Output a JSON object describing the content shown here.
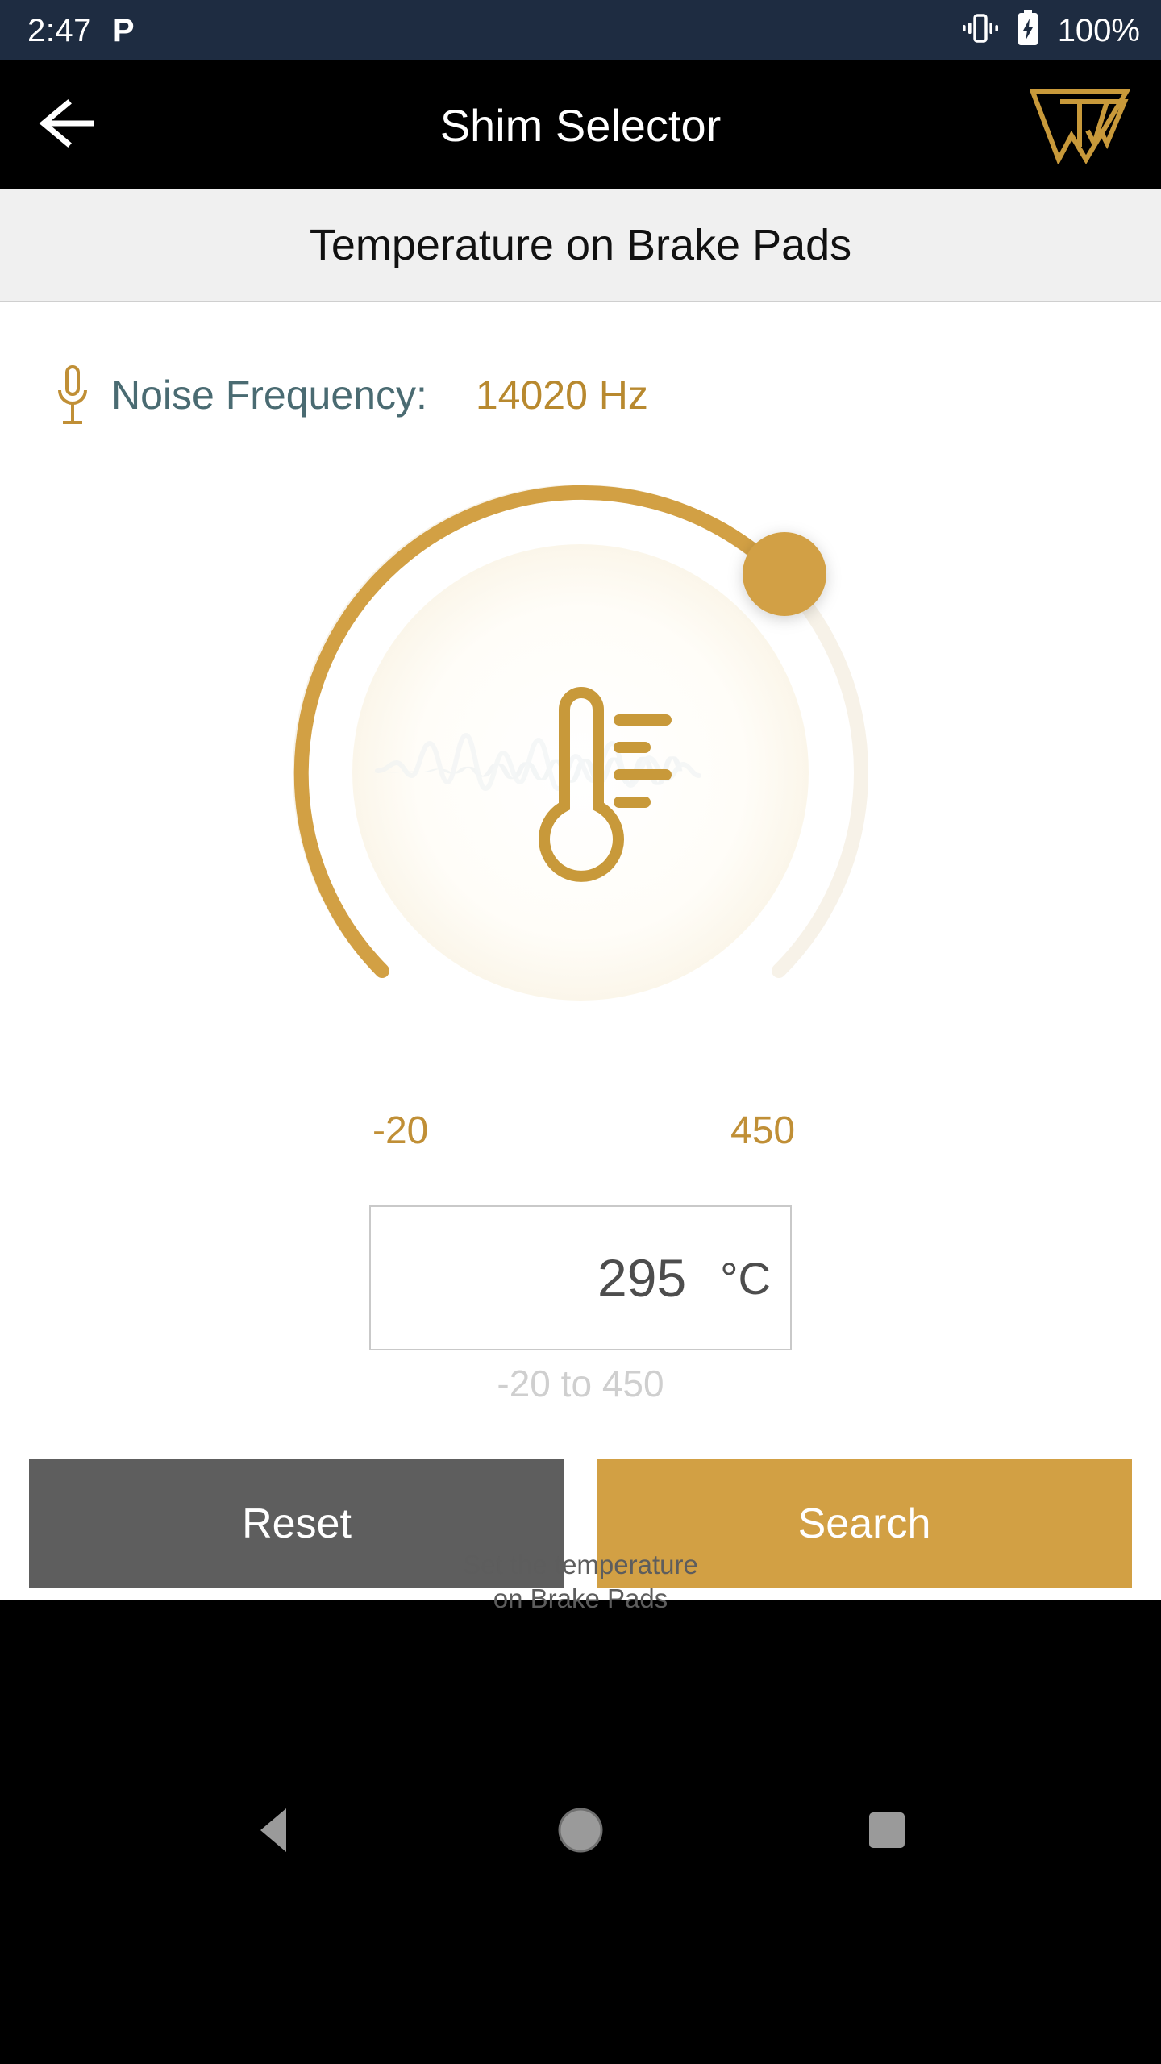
{
  "status_bar": {
    "time": "2:47",
    "app_icon_glyph": "P",
    "icons": [
      "vibrate-icon",
      "battery-charging-icon"
    ],
    "battery_percent": "100%",
    "background_color": "#1e2c41"
  },
  "app_bar": {
    "back_icon": "arrow-left-icon",
    "title": "Shim Selector",
    "logo_name": "tw-brand-logo",
    "background_color": "#000000",
    "logo_color": "#c8993a"
  },
  "subtitle": {
    "text": "Temperature on Brake Pads"
  },
  "noise_frequency": {
    "icon": "microphone-icon",
    "label": "Noise Frequency:",
    "value": "14020 Hz",
    "label_color": "#4a6b72",
    "value_color": "#b8892f"
  },
  "gauge": {
    "icon": "thermometer-icon",
    "caption_line1": "Set the temperature",
    "caption_line2": "on Brake Pads",
    "min_label": "-20",
    "max_label": "450",
    "min_value": -20,
    "max_value": 450,
    "current_value": 295,
    "progress_color": "#d2a044",
    "track_color": "#f7f2e8",
    "thumb_name": "gauge-thumb",
    "background_waveform": "audio-waveform-icon"
  },
  "value_input": {
    "value": "295",
    "unit": "°C",
    "hint": "-20 to 450"
  },
  "actions": {
    "reset_label": "Reset",
    "reset_color": "#5e5e5e",
    "search_label": "Search",
    "search_color": "#d2a044"
  },
  "nav_bar": {
    "items": [
      "back-triangle-icon",
      "home-circle-icon",
      "recents-square-icon"
    ],
    "background_color": "#000000",
    "icon_color": "#9a9a9a"
  },
  "chart_data": {
    "type": "gauge",
    "title": "Temperature on Brake Pads",
    "unit": "°C",
    "min": -20,
    "max": 450,
    "value": 295,
    "arc_start_deg": 135,
    "arc_sweep_deg": 270,
    "tick_labels": [
      "-20",
      "450"
    ]
  }
}
